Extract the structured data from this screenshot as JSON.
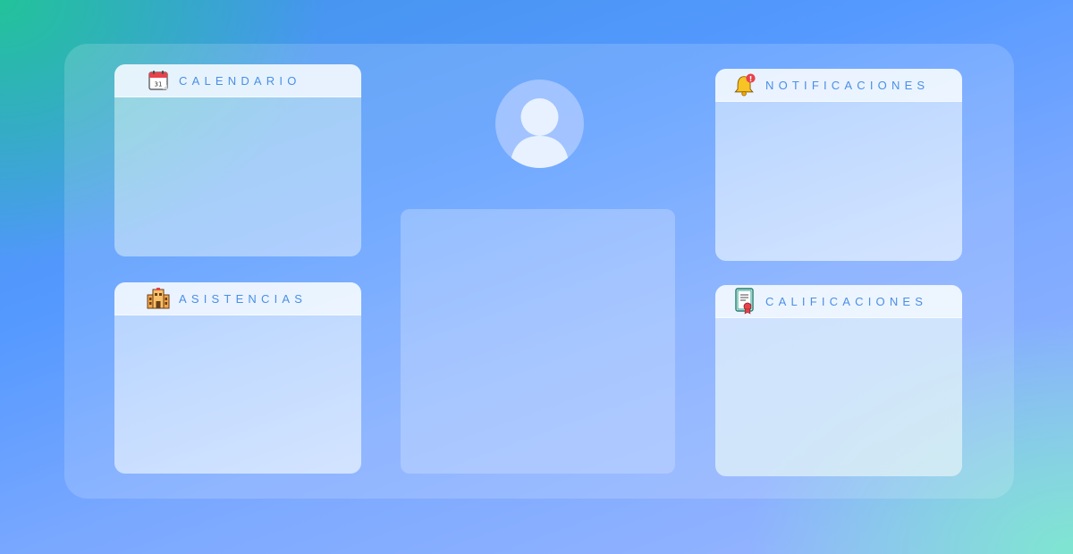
{
  "cards": {
    "calendario": {
      "title": "CALENDARIO",
      "icon": "calendar-icon",
      "icon_text": "31"
    },
    "asistencias": {
      "title": "ASISTENCIAS",
      "icon": "school-building-icon"
    },
    "notificaciones": {
      "title": "NOTIFICACIONES",
      "icon": "bell-icon",
      "badge_text": "!"
    },
    "calificaciones": {
      "title": "CALIFICACIONES",
      "icon": "certificate-icon"
    }
  },
  "profile": {
    "icon": "user-avatar-icon"
  },
  "colors": {
    "title_text": "#4a8fe6",
    "accent_red": "#e8424b",
    "bell_yellow": "#f7c325"
  }
}
